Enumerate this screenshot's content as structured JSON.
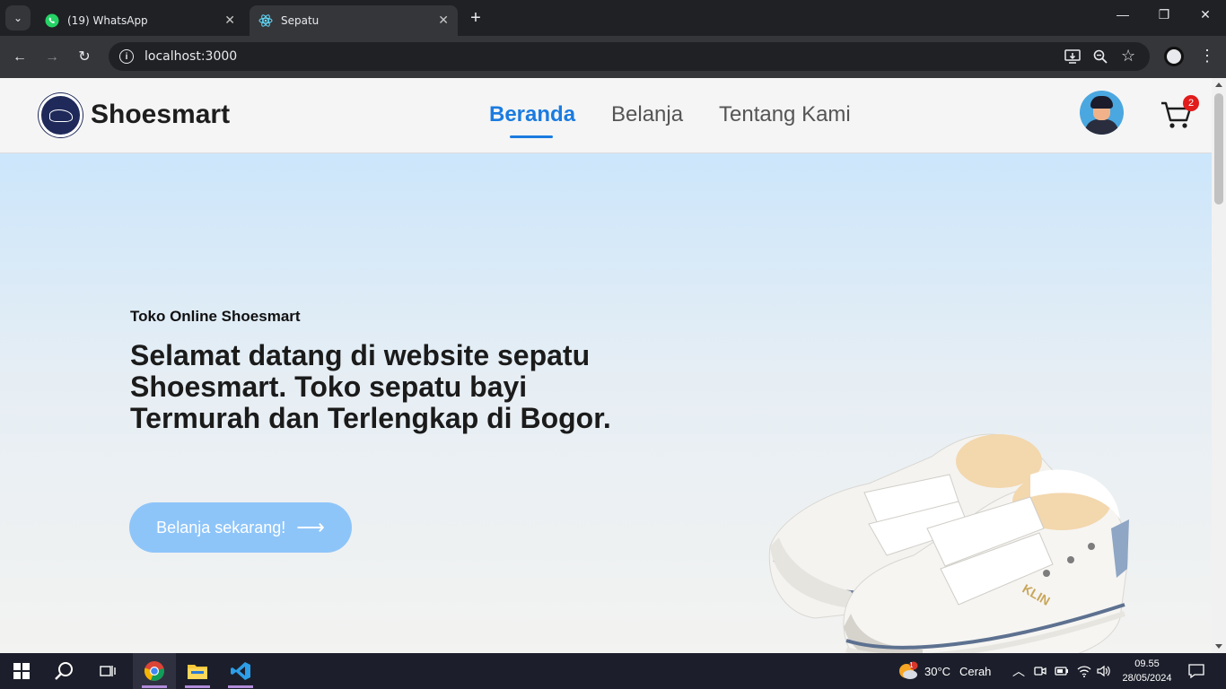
{
  "browser": {
    "tabs": [
      {
        "title": "(19) WhatsApp",
        "favicon": "whatsapp-icon",
        "active": false
      },
      {
        "title": "Sepatu",
        "favicon": "react-icon",
        "active": true
      }
    ],
    "url": "localhost:3000"
  },
  "navbar": {
    "brand": "Shoesmart",
    "links": [
      "Beranda",
      "Belanja",
      "Tentang Kami"
    ],
    "active_link": "Beranda",
    "cart_count": "2",
    "accent_color": "#1a7be0"
  },
  "hero": {
    "eyebrow": "Toko Online Shoesmart",
    "title": "Selamat datang di website sepatu Shoesmart. Toko sepatu bayi Termurah dan Terlengkap di Bogor.",
    "cta_label": "Belanja sekarang!",
    "cta_color": "#8ec5f9",
    "shoe_brand": "KLIN"
  },
  "taskbar": {
    "weather_temp": "30°C",
    "weather_desc": "Cerah",
    "weather_badge": "1",
    "time": "09.55",
    "date": "28/05/2024"
  }
}
